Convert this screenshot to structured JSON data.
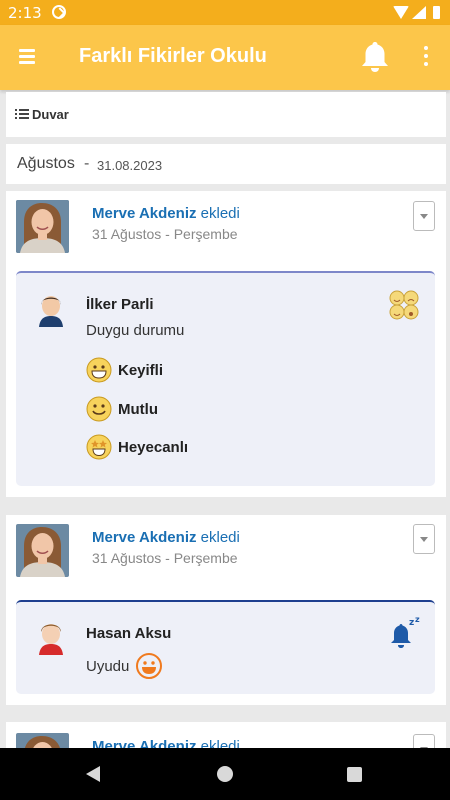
{
  "status_bar": {
    "time": "2:13"
  },
  "app_bar": {
    "title": "Farklı Fikirler Okulu"
  },
  "wall": {
    "label": "Duvar"
  },
  "month_header": {
    "month": "Ağustos",
    "separator": "-",
    "date": "31.08.2023"
  },
  "posts": [
    {
      "author": "Merve Akdeniz",
      "action": "ekledi",
      "date": "31 Ağustos - Perşembe",
      "card": {
        "student": "İlker Parli",
        "text": "Duygu durumu",
        "type_icon": "emotions-icon",
        "moods": [
          {
            "label": "Keyifli",
            "icon": "grinning-face-icon"
          },
          {
            "label": "Mutlu",
            "icon": "smiling-face-icon"
          },
          {
            "label": "Heyecanlı",
            "icon": "star-struck-face-icon"
          }
        ]
      }
    },
    {
      "author": "Merve Akdeniz",
      "action": "ekledi",
      "date": "31 Ağustos - Perşembe",
      "card": {
        "student": "Hasan Aksu",
        "text": "Uyudu",
        "type_icon": "sleep-bell-icon",
        "status_icon": "smiling-face-icon"
      }
    },
    {
      "author": "Merve Akdeniz",
      "action": "ekledi"
    }
  ],
  "colors": {
    "status_bar": "#f4ae1c",
    "app_bar": "#fcc64a",
    "author_link": "#1a6fb3",
    "card_bg": "#eef0f8"
  }
}
